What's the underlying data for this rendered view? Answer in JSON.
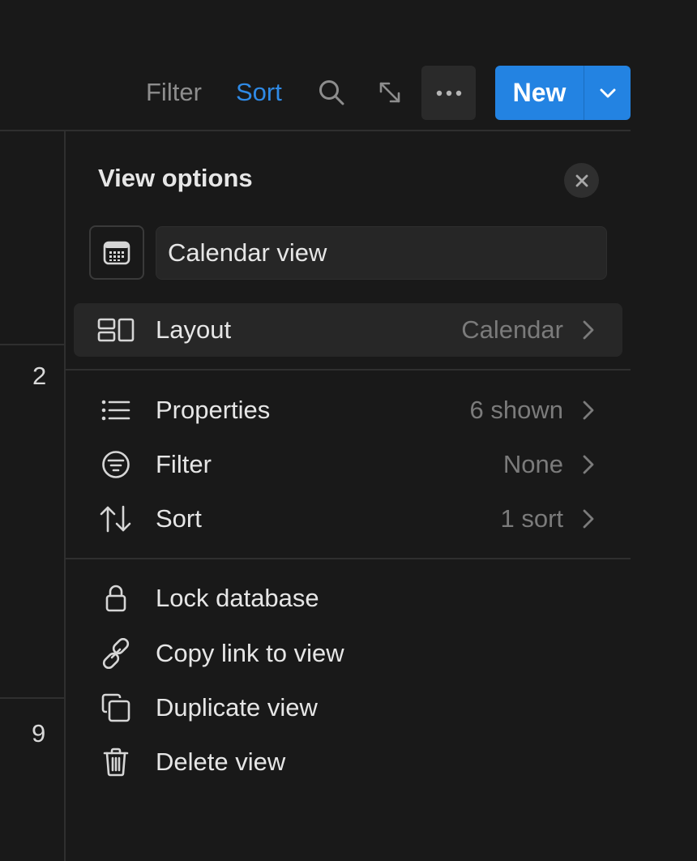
{
  "toolbar": {
    "filter_label": "Filter",
    "sort_label": "Sort",
    "new_label": "New",
    "sort_color": "#2f8ae6",
    "new_button_color": "#2383e2"
  },
  "calendar": {
    "day_numbers": [
      "2",
      "9"
    ]
  },
  "panel": {
    "title": "View options",
    "view_name": "Calendar view",
    "layout": {
      "label": "Layout",
      "value": "Calendar",
      "icon": "layout-icon"
    },
    "settings": [
      {
        "label": "Properties",
        "value": "6 shown",
        "icon": "list-icon"
      },
      {
        "label": "Filter",
        "value": "None",
        "icon": "filter-icon"
      },
      {
        "label": "Sort",
        "value": "1 sort",
        "icon": "sort-arrows-icon"
      }
    ],
    "actions": [
      {
        "label": "Lock database",
        "icon": "lock-icon"
      },
      {
        "label": "Copy link to view",
        "icon": "link-icon"
      },
      {
        "label": "Duplicate view",
        "icon": "duplicate-icon"
      },
      {
        "label": "Delete view",
        "icon": "trash-icon"
      }
    ]
  }
}
